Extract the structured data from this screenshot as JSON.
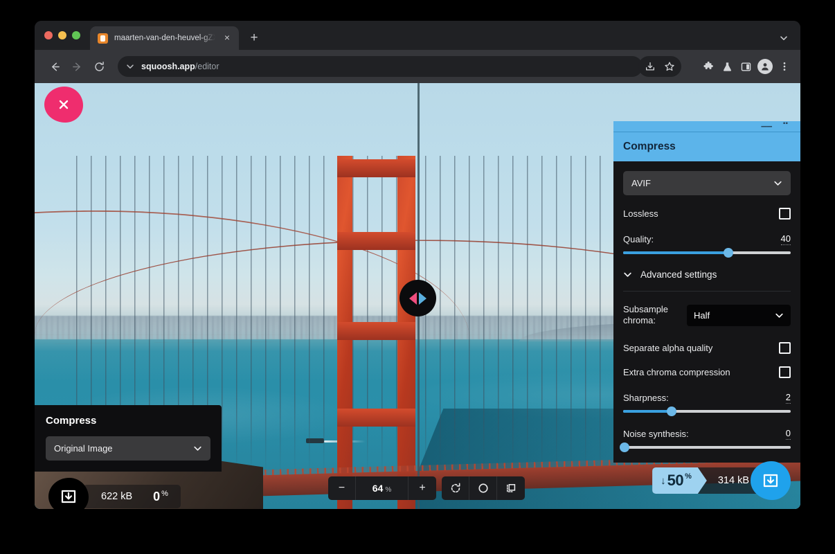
{
  "browser": {
    "tab": {
      "title": "maarten-van-den-heuvel-gZX",
      "favicon": "squoosh-favicon",
      "close_label": "×"
    },
    "new_tab_label": "+",
    "omnibox": {
      "host": "squoosh.app",
      "path": "/editor"
    },
    "toolbar_icons": [
      "install-app-icon",
      "bookmark-star-icon",
      "extensions-puzzle-icon",
      "labs-beaker-icon",
      "side-panel-icon",
      "profile-avatar-icon",
      "more-menu-icon"
    ]
  },
  "editor": {
    "close_label": "×",
    "compare_handle": "compare-drag-handle",
    "zoom": {
      "decrease_label": "−",
      "value": "64",
      "unit": "%",
      "increase_label": "+",
      "rotate_label": "rotate-icon",
      "toggle_label": "circle-icon",
      "fit_label": "fit-to-screen-icon"
    }
  },
  "left_panel": {
    "title": "Compress",
    "format_select": {
      "value": "Original Image"
    },
    "stats": {
      "size": "622 kB",
      "percent": "0",
      "percent_unit": "%"
    },
    "download_label": "download-icon"
  },
  "right_panel": {
    "title": "Compress",
    "format_select": {
      "value": "AVIF"
    },
    "lossless": {
      "label": "Lossless",
      "checked": false
    },
    "quality": {
      "label": "Quality:",
      "value": "40",
      "fill_percent": 63
    },
    "advanced_settings": {
      "label": "Advanced settings",
      "expanded": true
    },
    "subsample_chroma": {
      "label": "Subsample chroma:",
      "value": "Half"
    },
    "separate_alpha_quality": {
      "label": "Separate alpha quality",
      "checked": false
    },
    "extra_chroma_compression": {
      "label": "Extra chroma compression",
      "checked": false
    },
    "sharpness": {
      "label": "Sharpness:",
      "value": "2",
      "fill_percent": 29
    },
    "noise_synthesis": {
      "label": "Noise synthesis:",
      "value": "0",
      "fill_percent": 1
    }
  },
  "right_stats": {
    "reduction_arrow": "↓",
    "reduction_value": "50",
    "reduction_unit": "%",
    "size": "314 kB",
    "download_label": "download-icon"
  },
  "colors": {
    "accent_blue": "#5cb4ea",
    "download_blue": "#1fa2ec",
    "close_pink": "#ef2d6e",
    "badge_blue": "#9ed2f0"
  }
}
